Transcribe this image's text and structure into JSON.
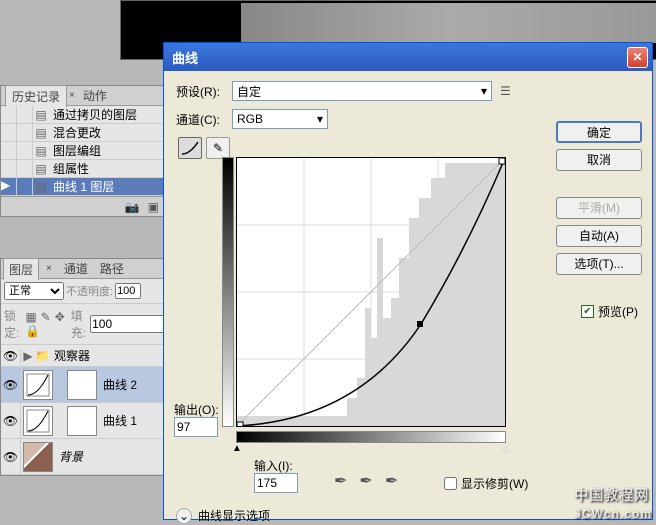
{
  "history_panel": {
    "tabs": [
      "历史记录",
      "动作"
    ],
    "items": [
      {
        "label": "通过拷贝的图层"
      },
      {
        "label": "混合更改"
      },
      {
        "label": "图层编组"
      },
      {
        "label": "组属性"
      },
      {
        "label": "曲线 1 图层"
      }
    ]
  },
  "layers_panel": {
    "tabs": [
      "图层",
      "通道",
      "路径"
    ],
    "blend_mode": "正常",
    "opacity_label": "不透明度:",
    "opacity_value": "100",
    "lock_label": "锁定:",
    "fill_label": "填充:",
    "fill_value": "100",
    "group": "观察器",
    "layers": [
      {
        "name": "曲线 2"
      },
      {
        "name": "曲线 1"
      },
      {
        "name": "背景"
      }
    ]
  },
  "dialog": {
    "title": "曲线",
    "preset_label": "预设(R):",
    "preset_value": "自定",
    "channel_label": "通道(C):",
    "channel_value": "RGB",
    "output_label": "输出(O):",
    "output_value": "97",
    "input_label": "输入(I):",
    "input_value": "175",
    "show_clip": "显示修剪(W)",
    "display_options": "曲线显示选项",
    "buttons": {
      "ok": "确定",
      "cancel": "取消",
      "smooth": "平滑(M)",
      "auto": "自动(A)",
      "options": "选项(T)..."
    },
    "preview": "预览(P)"
  },
  "chart_data": {
    "type": "line",
    "title": "曲线",
    "xlabel": "输入",
    "ylabel": "输出",
    "xlim": [
      0,
      255
    ],
    "ylim": [
      0,
      255
    ],
    "series": [
      {
        "name": "curve",
        "points": [
          [
            0,
            0
          ],
          [
            175,
            97
          ],
          [
            255,
            255
          ]
        ]
      },
      {
        "name": "baseline",
        "points": [
          [
            0,
            0
          ],
          [
            255,
            255
          ]
        ]
      }
    ],
    "selected_point": {
      "input": 175,
      "output": 97
    }
  },
  "watermark": {
    "cn": "中国教程网",
    "en": "JCWcn.com"
  }
}
